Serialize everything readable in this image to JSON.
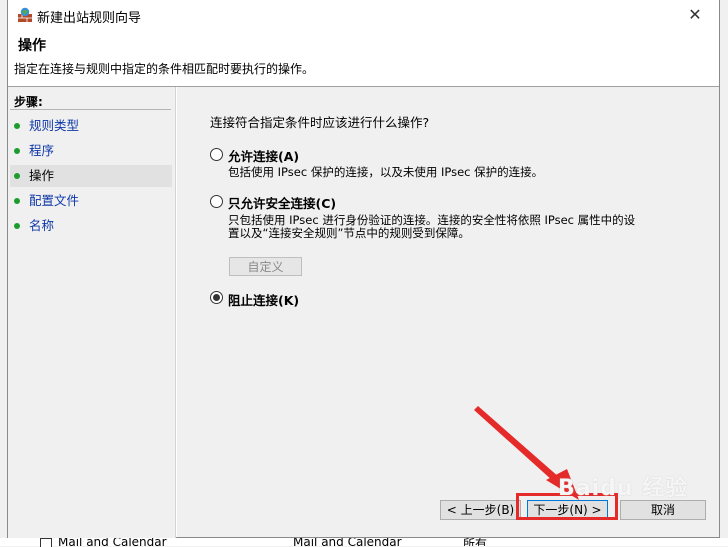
{
  "window": {
    "title": "新建出站规则向导",
    "close_glyph": "✕"
  },
  "header": {
    "title": "操作",
    "description": "指定在连接与规则中指定的条件相匹配时要执行的操作。"
  },
  "sidebar": {
    "heading": "步骤:",
    "items": [
      {
        "label": "规则类型"
      },
      {
        "label": "程序"
      },
      {
        "label": "操作",
        "current": true
      },
      {
        "label": "配置文件"
      },
      {
        "label": "名称"
      }
    ]
  },
  "main": {
    "question": "连接符合指定条件时应该进行什么操作?",
    "options": [
      {
        "label": "允许连接(A)",
        "description": "包括使用 IPsec 保护的连接，以及未使用 IPsec 保护的连接。",
        "selected": false
      },
      {
        "label": "只允许安全连接(C)",
        "description_line1": "只包括使用 IPsec 进行身份验证的连接。连接的安全性将依照 IPsec 属性中的设",
        "description_line2": "置以及“连接安全规则”节点中的规则受到保障。",
        "selected": false
      },
      {
        "label": "阻止连接(K)",
        "selected": true
      }
    ],
    "customize_button": "自定义"
  },
  "footer": {
    "back_button": "< 上一步(B)",
    "next_button": "下一步(N) >",
    "cancel_button": "取消"
  },
  "background_row": {
    "col1": "Mail and Calendar",
    "col2": "Mail and Calendar",
    "col3": "所有"
  },
  "watermark": "Baidu 经验",
  "colors": {
    "accent": "#0078d7",
    "step_link": "#0e38a8",
    "step_dot": "#1c9c2c",
    "highlight": "#e52a2a"
  }
}
